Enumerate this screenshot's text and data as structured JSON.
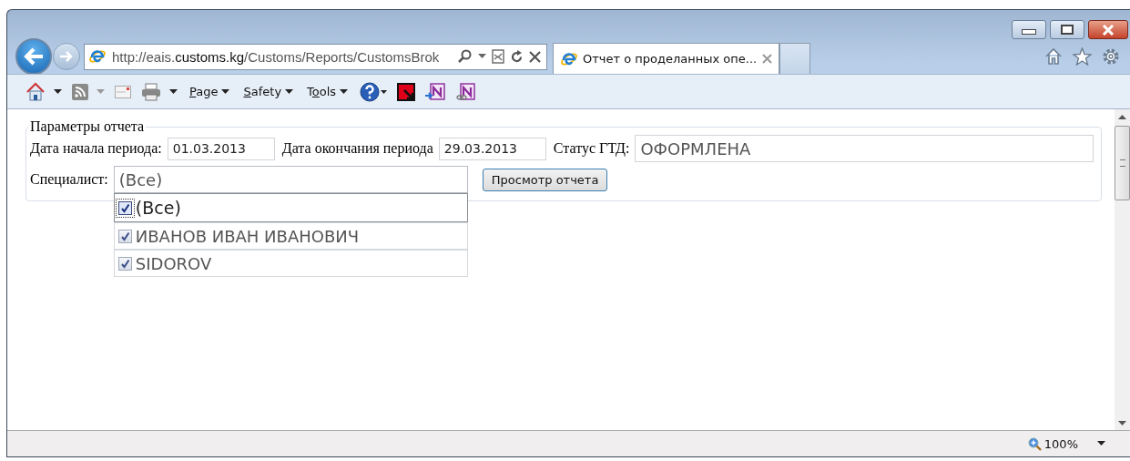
{
  "address_bar": {
    "url": "http://eais.**customs.kg**/Customs/Reports/CustomsBrok"
  },
  "tabs": [
    {
      "label": "Отчет о проделанных опе...",
      "selected": true
    }
  ],
  "command_bar": {
    "menus": [
      {
        "key": "P",
        "post": "age"
      },
      {
        "key": "S",
        "post": "afety"
      },
      {
        "pre": "T",
        "key": "o",
        "post": "ols"
      }
    ]
  },
  "form": {
    "legend": "Параметры отчета",
    "start_label": "Дата начала периода:",
    "start_value": "01.03.2013",
    "end_label": "Дата окончания периода",
    "end_value": "29.03.2013",
    "status_label": "Статус ГТД:",
    "status_value": "ОФОРМЛЕНА",
    "specialist_label": "Специалист:",
    "specialist_value": "(Все)",
    "view_button": "Просмотр отчета"
  },
  "dropdown": {
    "expanded": true,
    "options": [
      {
        "label": "(Все)",
        "checked": true,
        "focused": true
      },
      {
        "label": "ИВАНОВ ИВАН ИВАНОВИЧ",
        "checked": true,
        "focused": false
      },
      {
        "label": "SIDOROV",
        "checked": true,
        "focused": false
      }
    ]
  },
  "status_bar": {
    "zoom": "100%"
  }
}
